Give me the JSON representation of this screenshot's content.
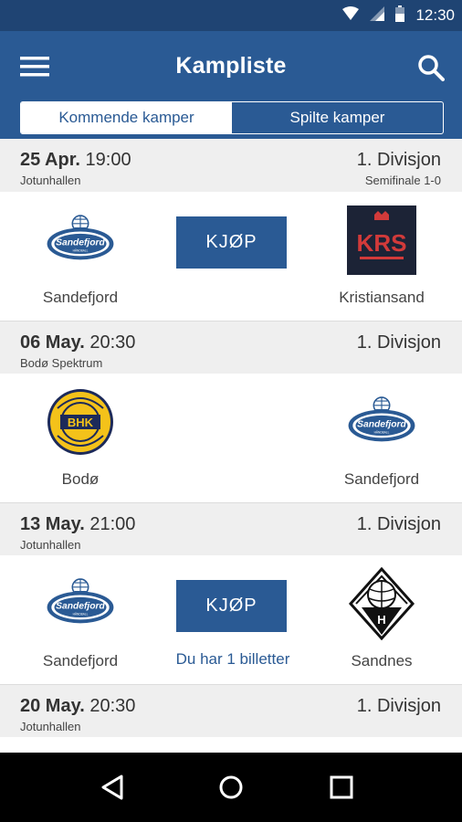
{
  "status_bar": {
    "time": "12:30",
    "icons": [
      "wifi-icon",
      "cell-signal-icon",
      "battery-icon"
    ]
  },
  "app_bar": {
    "title": "Kampliste",
    "menu_icon": "hamburger-menu-icon",
    "search_icon": "search-icon"
  },
  "tabs": [
    {
      "label": "Kommende kamper",
      "active": true
    },
    {
      "label": "Spilte kamper",
      "active": false
    }
  ],
  "matches": [
    {
      "date": "25 Apr.",
      "time": "19:00",
      "venue": "Jotunhallen",
      "division": "1. Divisjon",
      "round": "Semifinale 1-0",
      "home": {
        "name": "Sandefjord",
        "logo": "sandefjord-logo"
      },
      "away": {
        "name": "Kristiansand",
        "logo": "kristiansand-logo"
      },
      "buy_label": "KJØP"
    },
    {
      "date": "06 May.",
      "time": "20:30",
      "venue": "Bodø Spektrum",
      "division": "1. Divisjon",
      "home": {
        "name": "Bodø",
        "logo": "bodo-bhk-logo"
      },
      "away": {
        "name": "Sandefjord",
        "logo": "sandefjord-logo"
      }
    },
    {
      "date": "13 May.",
      "time": "21:00",
      "venue": "Jotunhallen",
      "division": "1. Divisjon",
      "home": {
        "name": "Sandefjord",
        "logo": "sandefjord-logo"
      },
      "away": {
        "name": "Sandnes",
        "logo": "sandnes-logo"
      },
      "buy_label": "KJØP",
      "ticket_note": "Du har 1 billetter"
    },
    {
      "date": "20 May.",
      "time": "20:30",
      "venue": "Jotunhallen",
      "division": "1. Divisjon"
    }
  ],
  "nav_bar": {
    "buttons": [
      "back-icon",
      "home-icon",
      "recents-icon"
    ]
  },
  "colors": {
    "primary": "#2a5a94",
    "status_bar": "#1f4473",
    "header_bg": "#efefef"
  }
}
